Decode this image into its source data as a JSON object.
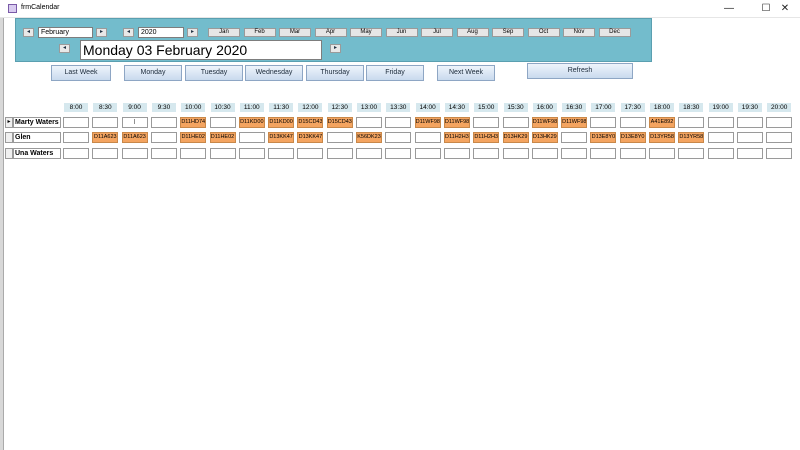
{
  "window": {
    "title": "frmCalendar",
    "minimize": "—",
    "maximize": "☐",
    "close": "✕"
  },
  "nav": {
    "prev": "◂",
    "next": "▸",
    "prev_arrow": "◂",
    "next_arrow": "▸"
  },
  "month_combo": {
    "value": "February"
  },
  "year_combo": {
    "value": "2020"
  },
  "months": [
    "Jan",
    "Feb",
    "Mar",
    "Apr",
    "May",
    "Jun",
    "Jul",
    "Aug",
    "Sep",
    "Oct",
    "Nov",
    "Dec"
  ],
  "date_display": "Monday 03 February 2020",
  "buttons": {
    "last_week": "Last Week",
    "monday": "Monday",
    "tuesday": "Tuesday",
    "wednesday": "Wednesday",
    "thursday": "Thursday",
    "friday": "Friday",
    "next_week": "Next Week",
    "refresh": "Refresh"
  },
  "times": [
    "8:00",
    "8:30",
    "9:00",
    "9:30",
    "10:00",
    "10:30",
    "11:00",
    "11:30",
    "12:00",
    "12:30",
    "13:00",
    "13:30",
    "14:00",
    "14:30",
    "15:00",
    "15:30",
    "16:00",
    "16:30",
    "17:00",
    "17:30",
    "18:00",
    "18:30",
    "19:00",
    "19:30",
    "20:00"
  ],
  "rows": [
    {
      "name": "Marty Waters",
      "selector": "▸",
      "cells": [
        "",
        "",
        "|",
        "",
        "D11HD74",
        "",
        "D11KD00",
        "D11KD00",
        "D15CD43",
        "D15CD43",
        "",
        "",
        "D11WF98",
        "D11WF98",
        "",
        "",
        "D11WF98",
        "D11WF98",
        "",
        "",
        "A41E892",
        "",
        "",
        "",
        ""
      ]
    },
    {
      "name": "Glen",
      "selector": "",
      "cells": [
        "",
        "D11A623",
        "D11A623",
        "",
        "D11HE02",
        "D11HE02",
        "",
        "D13KK47",
        "D13KK47",
        "",
        "K56DK23",
        "",
        "",
        "D11H2H3",
        "D11H2H3",
        "D13HK29",
        "D13HK29",
        "",
        "D13E8Y0",
        "D13E8Y0",
        "D13YR58",
        "D13YR58",
        "",
        "",
        ""
      ]
    },
    {
      "name": "Una Waters",
      "selector": "",
      "cells": [
        "",
        "",
        "",
        "",
        "",
        "",
        "",
        "",
        "",
        "",
        "",
        "",
        "",
        "",
        "",
        "",
        "",
        "",
        "",
        "",
        "",
        "",
        "",
        "",
        ""
      ]
    }
  ],
  "colors": {
    "panel": "#73bccc",
    "booked": "#f4a460",
    "time_header": "#d6e8ee"
  }
}
